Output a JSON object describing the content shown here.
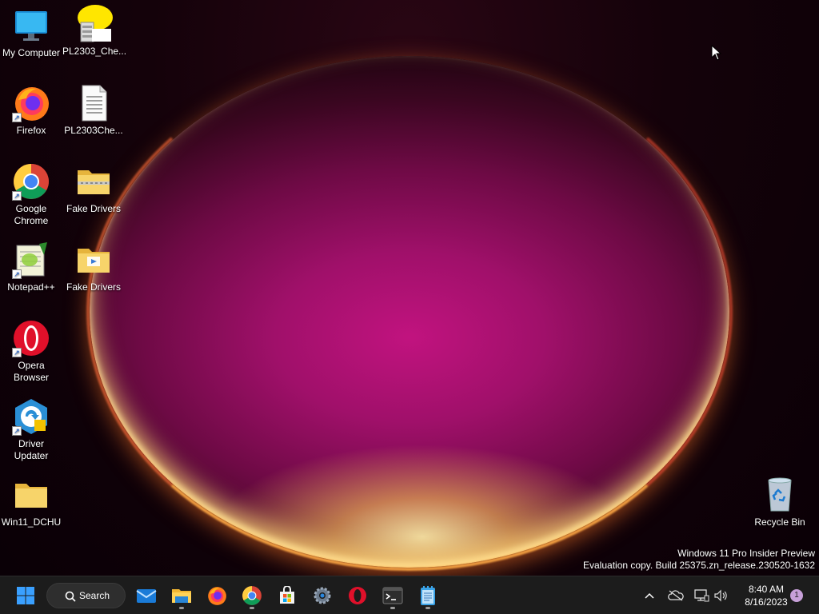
{
  "desktop": {
    "icons": [
      {
        "label": "My Computer",
        "icon": "monitor-icon"
      },
      {
        "label": "PL2303_Che...",
        "icon": "installer-icon"
      },
      {
        "label": "Firefox",
        "icon": "firefox-icon"
      },
      {
        "label": "PL2303Che...",
        "icon": "text-file-icon"
      },
      {
        "label": "Google Chrome",
        "icon": "chrome-icon"
      },
      {
        "label": "Fake Drivers",
        "icon": "zip-folder-icon"
      },
      {
        "label": "Notepad++",
        "icon": "notepadpp-icon"
      },
      {
        "label": "Fake Drivers",
        "icon": "folder-icon"
      },
      {
        "label": "Opera Browser",
        "icon": "opera-icon"
      },
      {
        "label": "Driver Updater",
        "icon": "driver-updater-icon"
      },
      {
        "label": "Win11_DCHU",
        "icon": "folder-icon"
      },
      {
        "label": "Recycle Bin",
        "icon": "recycle-bin-icon"
      }
    ],
    "watermark": {
      "line1": "Windows 11 Pro Insider Preview",
      "line2": "Evaluation copy. Build 25375.zn_release.230520-1632"
    }
  },
  "taskbar": {
    "start_icon": "windows-start-icon",
    "search_label": "Search",
    "pinned": [
      "mail-icon",
      "file-explorer-icon",
      "firefox-icon",
      "chrome-icon",
      "microsoft-store-icon",
      "settings-icon",
      "opera-icon",
      "terminal-icon",
      "notepad-icon"
    ],
    "tray": {
      "icons": [
        "chevron-up-icon",
        "onedrive-offline-icon",
        "network-icon",
        "volume-icon"
      ],
      "time": "8:40 AM",
      "date": "8/16/2023",
      "notification_count": "1"
    }
  },
  "colors": {
    "taskbar_bg": "#1c1c1c",
    "accent_blue": "#0a84ff"
  }
}
